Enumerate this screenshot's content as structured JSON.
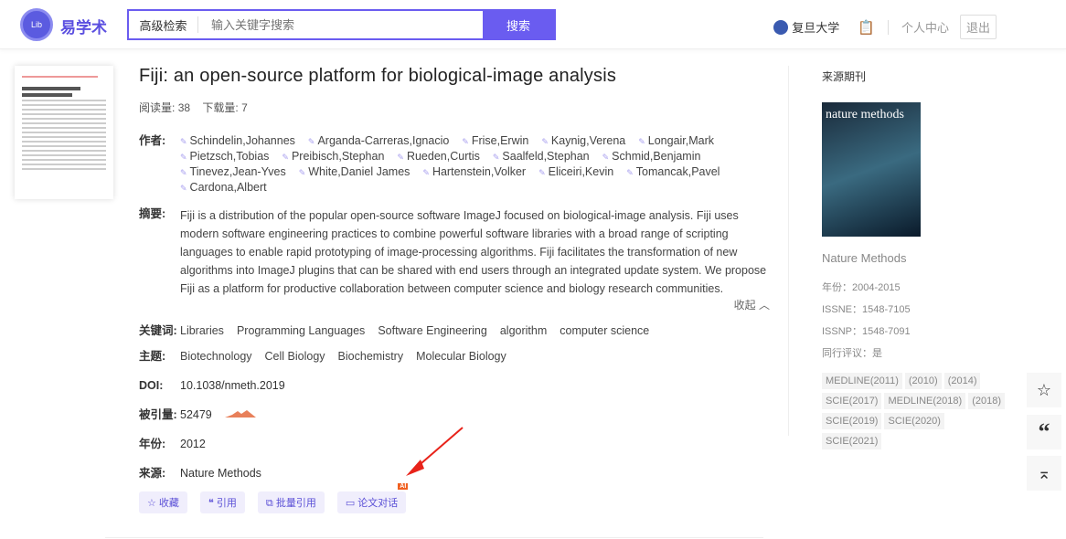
{
  "header": {
    "logo_text": "易学术",
    "logo_mark": "Lib",
    "adv_search": "高级检索",
    "search_placeholder": "输入关键字搜索",
    "search_btn": "搜索",
    "institution": "复旦大学",
    "personal": "个人中心",
    "logout": "退出"
  },
  "paper": {
    "title": "Fiji: an open-source platform for biological-image analysis",
    "reads_label": "阅读量:",
    "reads": "38",
    "downloads_label": "下载量:",
    "downloads": "7",
    "authors_label": "作者:",
    "authors": [
      "Schindelin,Johannes",
      "Arganda-Carreras,Ignacio",
      "Frise,Erwin",
      "Kaynig,Verena",
      "Longair,Mark",
      "Pietzsch,Tobias",
      "Preibisch,Stephan",
      "Rueden,Curtis",
      "Saalfeld,Stephan",
      "Schmid,Benjamin",
      "Tinevez,Jean-Yves",
      "White,Daniel James",
      "Hartenstein,Volker",
      "Eliceiri,Kevin",
      "Tomancak,Pavel",
      "Cardona,Albert"
    ],
    "abstract_label": "摘要:",
    "abstract": "Fiji is a distribution of the popular open-source software ImageJ focused on biological-image analysis. Fiji uses modern software engineering practices to combine powerful software libraries with a broad range of scripting languages to enable rapid prototyping of image-processing algorithms. Fiji facilitates the transformation of new algorithms into ImageJ plugins that can be shared with end users through an integrated update system. We propose Fiji as a platform for productive collaboration between computer science and biology research communities.",
    "collapse": "收起 ︿",
    "keywords_label": "关键词:",
    "keywords": [
      "Libraries",
      "Programming Languages",
      "Software Engineering",
      "algorithm",
      "computer science"
    ],
    "subjects_label": "主题:",
    "subjects": [
      "Biotechnology",
      "Cell Biology",
      "Biochemistry",
      "Molecular Biology"
    ],
    "doi_label": "DOI:",
    "doi": "10.1038/nmeth.2019",
    "cited_label": "被引量:",
    "cited": "52479",
    "year_label": "年份:",
    "year": "2012",
    "source_label": "来源:",
    "source": "Nature Methods",
    "actions": {
      "favorite": "☆ 收藏",
      "cite": "❝ 引用",
      "batch_cite": "⧉ 批量引用",
      "chat": "▭ 论文对话",
      "ai_badge": "AI"
    }
  },
  "journal": {
    "heading": "来源期刊",
    "cover_title": "nature methods",
    "name": "Nature Methods",
    "years": "年份：2004-2015",
    "issne": "ISSNE：1548-7105",
    "issnp": "ISSNP：1548-7091",
    "peer": "同行评议：是",
    "tags": [
      "MEDLINE(2011)",
      "(2010)",
      "(2014)",
      "SCIE(2017)",
      "MEDLINE(2018)",
      "(2018)",
      "SCIE(2019)",
      "SCIE(2020)",
      "SCIE(2021)"
    ]
  }
}
